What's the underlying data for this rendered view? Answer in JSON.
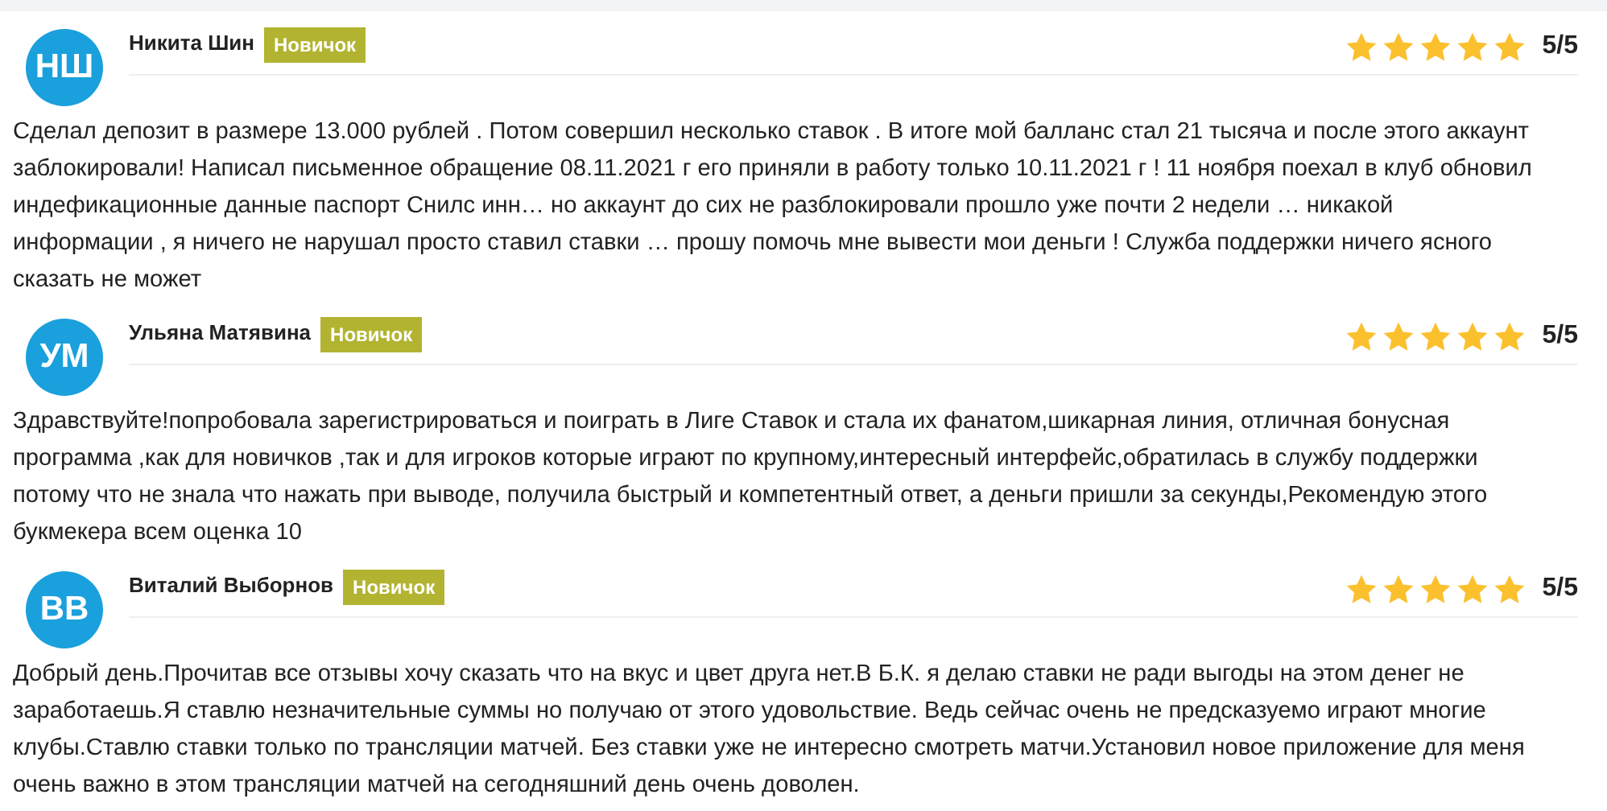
{
  "reviews": [
    {
      "initials": "НШ",
      "name": "Никита Шин",
      "badge": "Новичок",
      "stars": 5,
      "rating": "5/5",
      "text": "Сделал депозит в размере 13.000 рублей . Потом совершил несколько ставок . В итоге мой балланс стал 21 тысяча и после этого аккаунт заблокировали! Написал письменное обращение 08.11.2021 г его приняли в работу только 10.11.2021 г ! 11 ноября поехал в клуб обновил индефикационные данные паспорт Снилс инн… но аккаунт до сих не разблокировали прошло уже почти 2 недели … никакой\nинформации , я ничего не нарушал просто ставил ставки … прошу помочь мне вывести мои деньги ! Служба поддержки ничего ясного сказать не может"
    },
    {
      "initials": "УМ",
      "name": "Ульяна Матявина",
      "badge": "Новичок",
      "stars": 5,
      "rating": "5/5",
      "text": "Здравствуйте!попробовала зарегистрироваться и поиграть в Лиге Ставок и стала их фанатом,шикарная линия, отличная бонусная\nпрограмма ,как для новичков ,так и для игроков которые играют по крупному,интересный интерфейс,обратилась в службу поддержки\nпотому что не знала что нажать при выводе, получила быстрый и компетентный ответ, а деньги пришли за секунды,Рекомендую этого\nбукмекера всем оценка 10"
    },
    {
      "initials": "ВВ",
      "name": "Виталий Выборнов",
      "badge": "Новичок",
      "stars": 5,
      "rating": "5/5",
      "text": "Добрый день.Прочитав все отзывы хочу сказать что на вкус и цвет друга нет.В Б.К. я делаю ставки не ради выгоды на этом денег не заработаешь.Я ставлю незначительные суммы но получаю от этого удовольствие. Ведь сейчас очень не предсказуемо играют многие клубы.Ставлю ставки только по трансляции матчей. Без ставки уже не интересно смотреть матчи.Установил новое приложение для меня очень важно в этом трансляции матчей на сегодняшний день очень доволен."
    }
  ]
}
